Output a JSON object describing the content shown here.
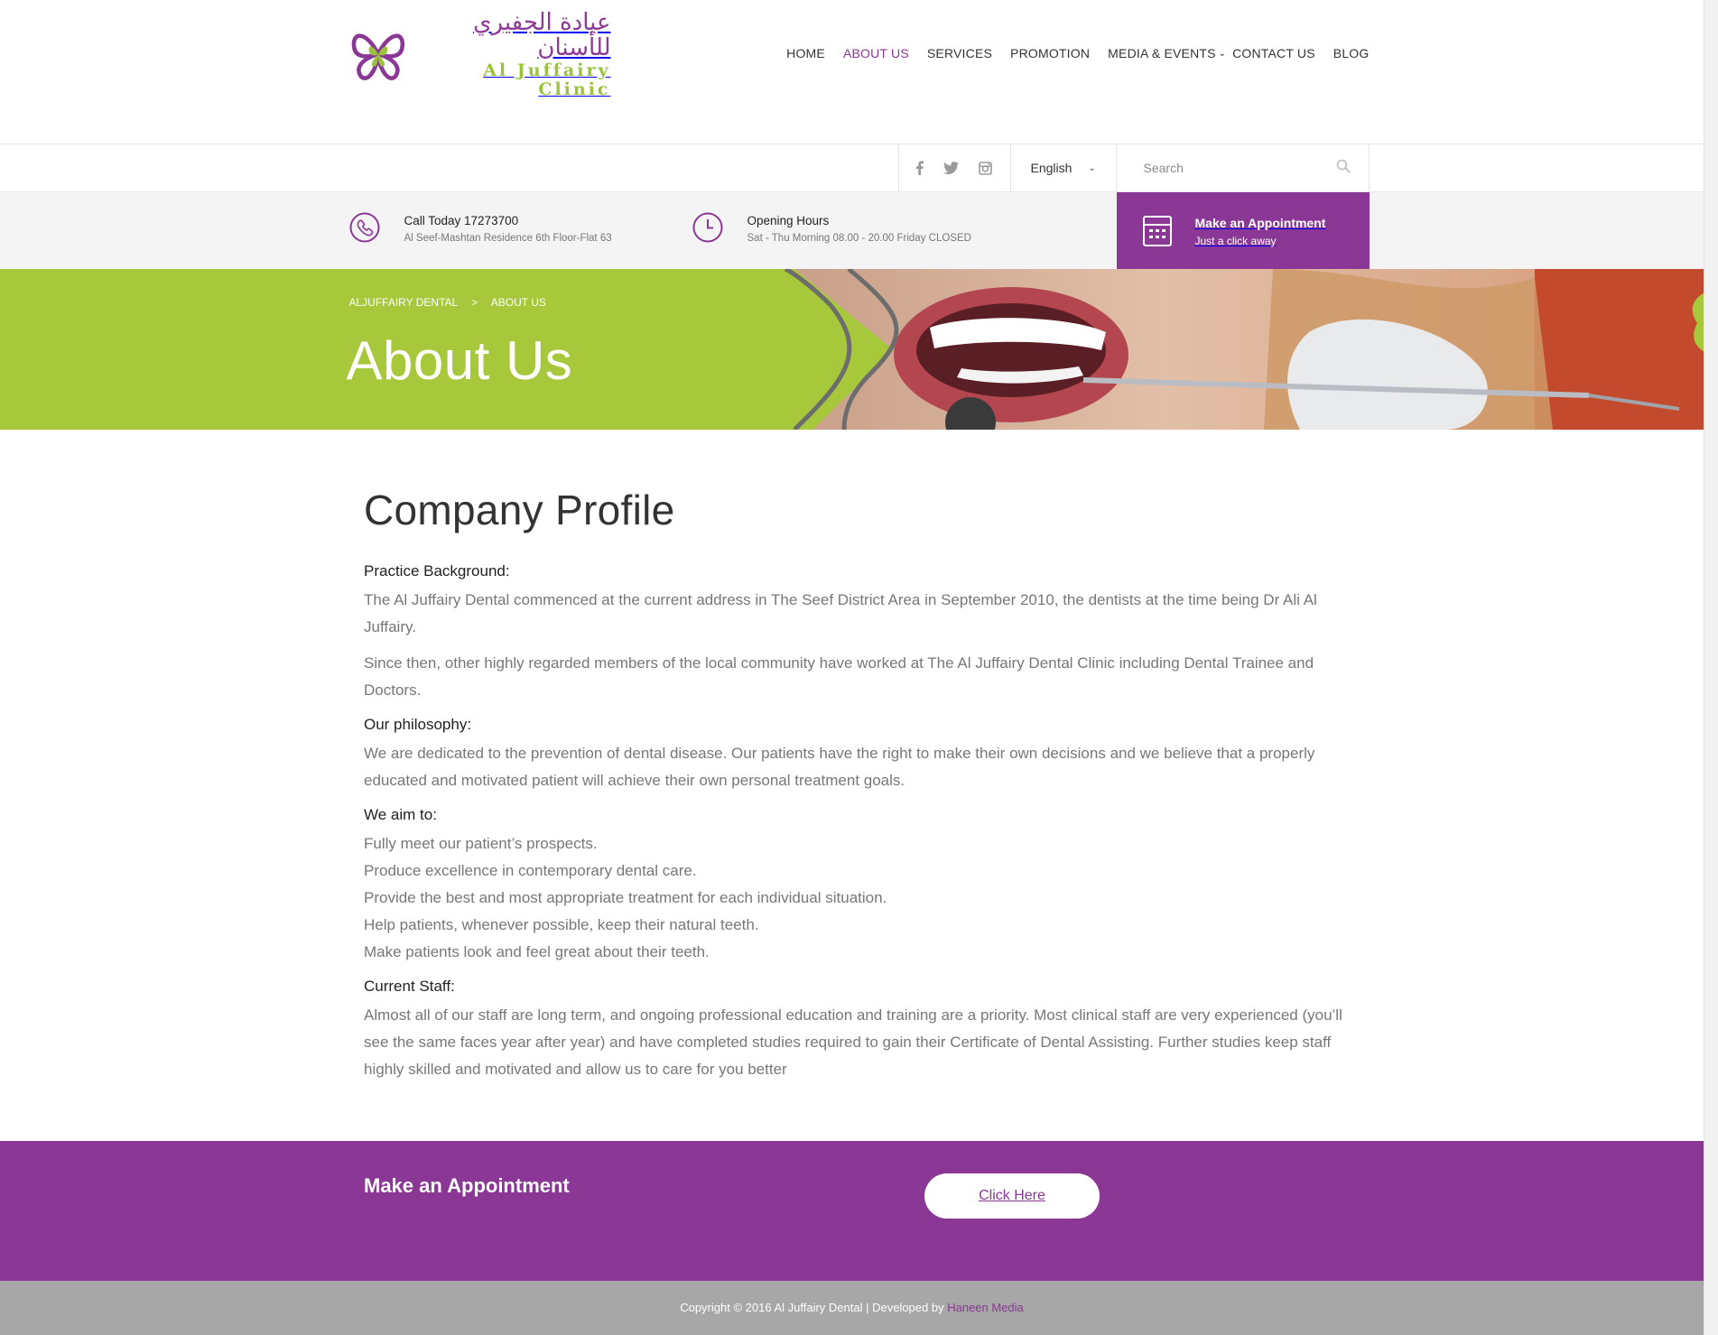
{
  "brand": {
    "name_ar": "عيادة الجفيري للأسنان",
    "name_en": "Al Juffairy Clinic",
    "colors": {
      "primary": "#8a3795",
      "accent": "#a7c83b"
    }
  },
  "nav": {
    "items": [
      {
        "label": "HOME"
      },
      {
        "label": "ABOUT US",
        "active": true
      },
      {
        "label": "SERVICES"
      },
      {
        "label": "PROMOTION"
      },
      {
        "label": "MEDIA & EVENTS",
        "dropdown": true
      },
      {
        "label": "CONTACT US"
      },
      {
        "label": "BLOG"
      }
    ]
  },
  "utility": {
    "social": [
      "facebook-icon",
      "twitter-icon",
      "instagram-icon"
    ],
    "language": "English",
    "search_placeholder": "Search"
  },
  "info": {
    "call_title": "Call Today 17273700",
    "call_sub": "Al Seef-Mashtan Residence 6th Floor-Flat 63",
    "hours_title": "Opening Hours",
    "hours_sub": "Sat - Thu Morning 08.00 - 20.00 Friday CLOSED",
    "appointment_title": "Make an Appointment",
    "appointment_sub": "Just a click away"
  },
  "banner": {
    "breadcrumb_root": "ALJUFFAIRY DENTAL",
    "breadcrumb_sep": ">",
    "breadcrumb_current": "ABOUT US",
    "title": "About Us"
  },
  "content": {
    "heading": "Company Profile",
    "background_title": "Practice Background:",
    "background_p1": "The Al Juffairy Dental commenced at the current address in The Seef District Area in September 2010, the dentists at the time being Dr Ali Al Juffairy.",
    "background_p2": "Since then, other highly regarded members of the local community have worked at The Al Juffairy Dental Clinic including Dental Trainee and Doctors.",
    "philosophy_title": "Our philosophy:",
    "philosophy_p": "We are dedicated to the prevention of dental disease. Our patients have the right to make their own decisions and we believe that a properly educated and motivated patient will achieve their own personal treatment goals.",
    "aims_title": "We aim to:",
    "aims": [
      "Fully meet our patient’s prospects.",
      "Produce excellence in contemporary dental care.",
      "Provide the best and most appropriate treatment for each individual situation.",
      "Help patients, whenever possible, keep their natural teeth.",
      "Make patients look and feel great about their teeth."
    ],
    "staff_title": "Current Staff:",
    "staff_p": "Almost all of our staff are long term, and ongoing professional education and training are a priority. Most clinical staff are very experienced (you’ll see the same faces year after year) and have completed studies required to gain their Certificate of Dental Assisting. Further studies keep staff highly skilled and motivated and allow us to care for you better"
  },
  "cta": {
    "title": "Make an Appointment",
    "button": "Click Here"
  },
  "footer": {
    "copyright": "Copyright © 2016 Al Juffairy Dental | Developed by",
    "developer": "Haneen Media"
  }
}
